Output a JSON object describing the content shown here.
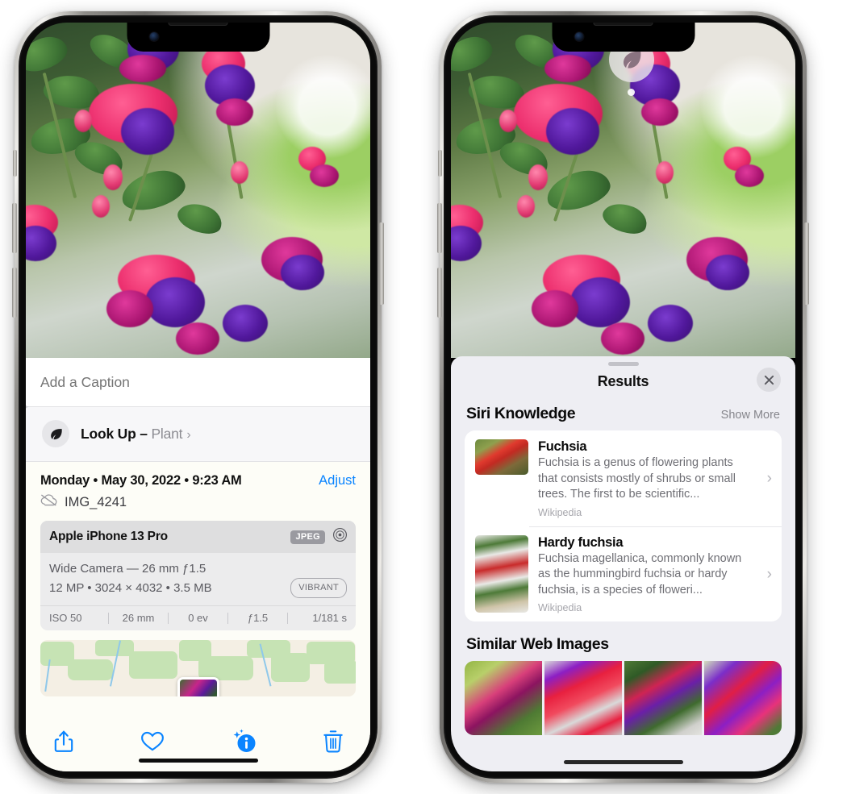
{
  "left_phone": {
    "caption": {
      "placeholder": "Add a Caption",
      "value": ""
    },
    "lookup": {
      "label": "Look Up – ",
      "subject": "Plant",
      "chevron": "›",
      "icon": "leaf-icon"
    },
    "meta": {
      "date": "Monday • May 30, 2022 • 9:23 AM",
      "adjust_label": "Adjust",
      "filename": "IMG_4241",
      "cloud_icon": "cloud-slash-icon"
    },
    "camera_card": {
      "model": "Apple iPhone 13 Pro",
      "format_tag": "JPEG",
      "raw_icon": "aperture-icon",
      "lens_line": "Wide Camera — 26 mm ƒ1.5",
      "size_line": "12 MP • 3024 × 4032 • 3.5 MB",
      "style_tag": "VIBRANT",
      "exif": [
        "ISO 50",
        "26 mm",
        "0 ev",
        "ƒ1.5",
        "1/181 s"
      ]
    },
    "toolbar": [
      {
        "name": "share-button",
        "icon": "share-icon"
      },
      {
        "name": "favorite-button",
        "icon": "heart-icon"
      },
      {
        "name": "info-button",
        "icon": "info-sparkle-icon"
      },
      {
        "name": "delete-button",
        "icon": "trash-icon"
      }
    ]
  },
  "right_phone": {
    "badge": {
      "icon": "leaf-icon"
    },
    "sheet": {
      "title": "Results",
      "close_icon": "close-icon",
      "sections": [
        {
          "title": "Siri Knowledge",
          "action_label": "Show More",
          "items": [
            {
              "title": "Fuchsia",
              "description": "Fuchsia is a genus of flowering plants that consists mostly of shrubs or small trees. The first to be scientific...",
              "source": "Wikipedia",
              "chevron": "›"
            },
            {
              "title": "Hardy fuchsia",
              "description": "Fuchsia magellanica, commonly known as the hummingbird fuchsia or hardy fuchsia, is a species of floweri...",
              "source": "Wikipedia",
              "chevron": "›"
            }
          ]
        },
        {
          "title": "Similar Web Images",
          "thumbnails": [
            "web-image-1",
            "web-image-2",
            "web-image-3",
            "web-image-4"
          ]
        }
      ]
    }
  },
  "colors": {
    "accent": "#0a84ff",
    "sheet_bg": "#eeeef3",
    "card_bg": "#ffffff",
    "secondary_text": "#6e6e74"
  }
}
